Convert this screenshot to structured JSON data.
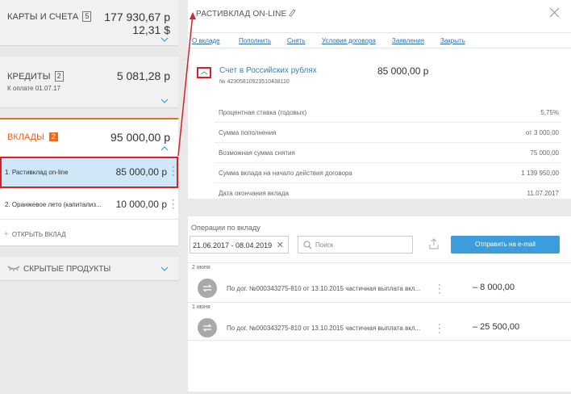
{
  "sidebar": {
    "cards": {
      "title": "КАРТЫ И СЧЕТА",
      "count": "5",
      "amount_rub": "177 930,67 р",
      "amount_usd": "12,31 $"
    },
    "credits": {
      "title": "КРЕДИТЫ",
      "count": "2",
      "amount": "5 081,28 р",
      "due": "К оплате 01.07.17"
    },
    "deposits": {
      "title": "ВКЛАДЫ",
      "count": "2",
      "amount": "95 000,00 р",
      "items": [
        {
          "name": "1. Растивклад on-line",
          "amount": "85 000,00 р"
        },
        {
          "name": "2. Оранжевое лето (капитализ...",
          "amount": "10 000,00 р"
        }
      ],
      "open_label": "ОТКРЫТЬ ВКЛАД"
    },
    "hidden": {
      "title": "СКРЫТЫЕ ПРОДУКТЫ"
    }
  },
  "panel": {
    "title": "РАСТИВКЛАД ON-LINE",
    "tabs": [
      "О вкладе",
      "Пополнить",
      "Снять",
      "Условия договора",
      "Заявления",
      "Закрыть"
    ],
    "account": {
      "title": "Счет в Российских рублях",
      "number": "№ 42305810923510438110",
      "amount": "85 000,00 р"
    },
    "info": [
      {
        "label": "Процентная ставка (годовых)",
        "value": "5,75%"
      },
      {
        "label": "Сумма пополнения",
        "value": "от 3 000,00"
      },
      {
        "label": "Возможная сумма снятия",
        "value": "75 000,00"
      },
      {
        "label": "Сумма вклада на начало действия договора",
        "value": "1 139 950,00"
      },
      {
        "label": "Дата окончания вклада",
        "value": "11.07.2017"
      }
    ]
  },
  "operations": {
    "title": "Операции по вкладу",
    "date_range": "21.06.2017 - 08.04.2019",
    "search_placeholder": "Поиск",
    "send_label": "Отправить на e-mail",
    "groups": [
      {
        "date": "2 июня",
        "desc": "По дог. №000343275-810 от 13.10.2015 частичная выплата вкл...",
        "amount": "– 8 000,00"
      },
      {
        "date": "1 июня",
        "desc": "По дог. №000343275-810 от 13.10.2015 частичная выплата вкл...",
        "amount": "– 25 500,00"
      }
    ]
  },
  "colors": {
    "accent": "#e86c1a",
    "link": "#2f6fa8",
    "highlight": "#d1232a",
    "button": "#3b9ddb"
  },
  "icons": [
    "pencil-icon",
    "close-icon",
    "chevron-down-icon",
    "chevron-up-icon",
    "search-icon",
    "export-icon",
    "transfer-icon",
    "more-icon",
    "plus-icon",
    "eye-hidden-icon"
  ]
}
